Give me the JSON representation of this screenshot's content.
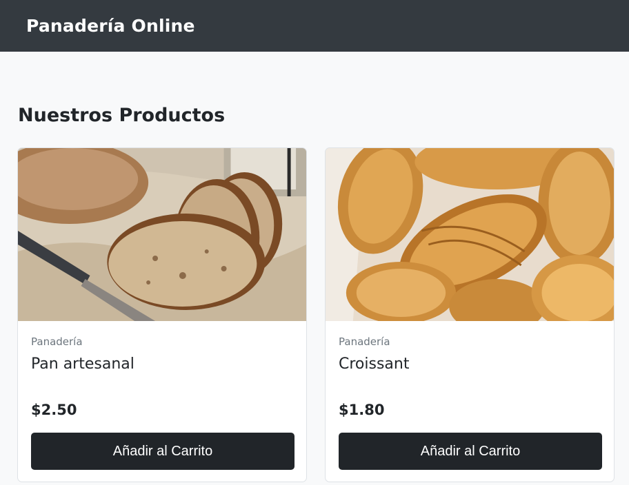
{
  "navbar": {
    "brand": "Panadería Online"
  },
  "main": {
    "section_title": "Nuestros Productos"
  },
  "products": [
    {
      "image": "sliced-sourdough-bread-photo",
      "category": "Panadería",
      "name": "Pan artesanal",
      "price": "$2.50",
      "button_label": "Añadir al Carrito"
    },
    {
      "image": "croissants-photo",
      "category": "Panadería",
      "name": "Croissant",
      "price": "$1.80",
      "button_label": "Añadir al Carrito"
    }
  ],
  "colors": {
    "navbar_bg": "#343a40",
    "page_bg": "#f8f9fa",
    "button_bg": "#212529",
    "muted_text": "#6c757d"
  }
}
